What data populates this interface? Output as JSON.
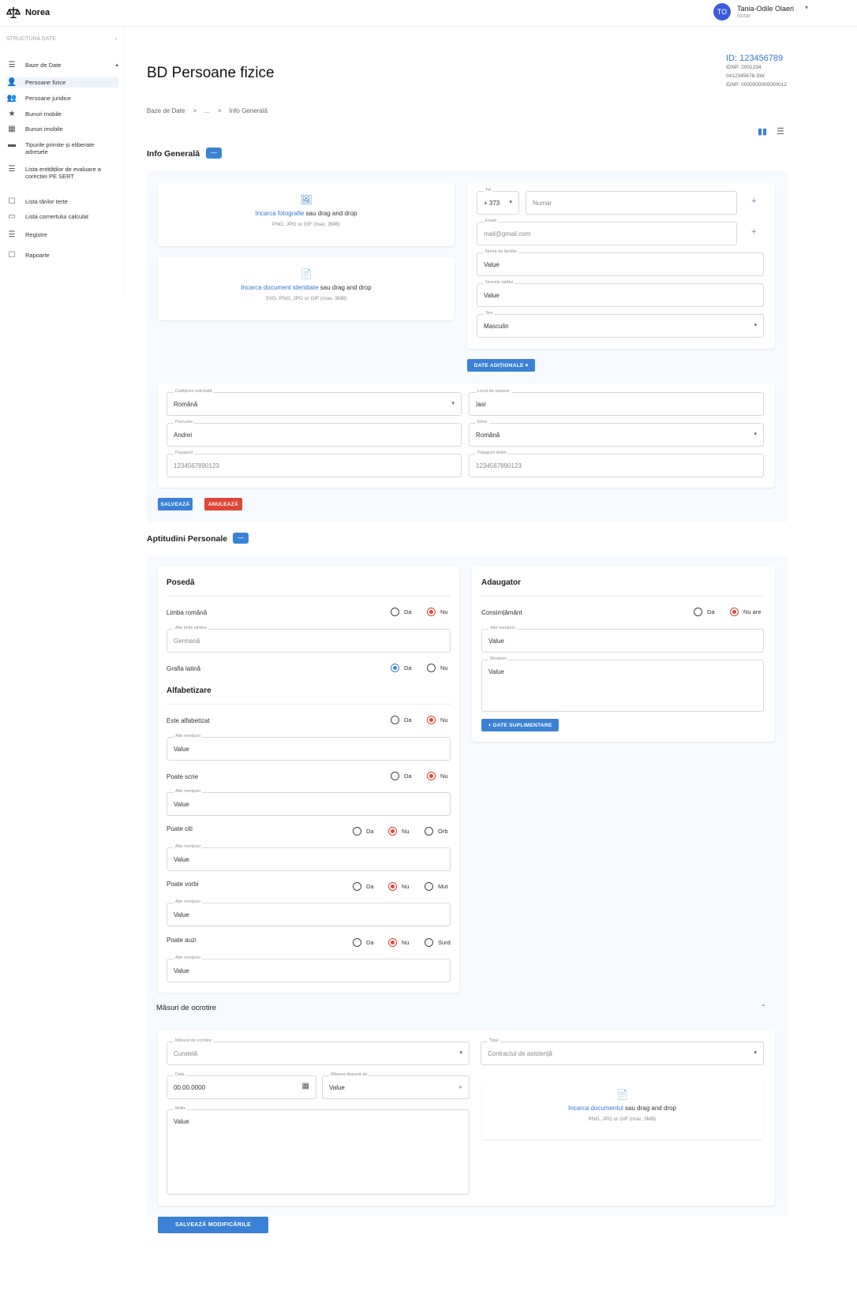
{
  "app": {
    "name": "Norea"
  },
  "user": {
    "initials": "TO",
    "name": "Tania-Odile Olaeri",
    "role": "Notar"
  },
  "sidebar": {
    "heading": "STRUCTURA DATE",
    "items": [
      {
        "label": "Baze de Date",
        "icon": "list-icon"
      },
      {
        "label": "Persoane fizice",
        "icon": "person-icon"
      },
      {
        "label": "Persoane juridice",
        "icon": "group-icon"
      },
      {
        "label": "Bunuri mobile",
        "icon": "star-icon"
      },
      {
        "label": "Bunuri imobile",
        "icon": "building-icon"
      },
      {
        "label": "Tipurile primite și eliberate adresele",
        "icon": "folder-icon"
      },
      {
        "label": "Lista entităților de evaluare a corectiei PE SERT",
        "icon": "list-icon"
      },
      {
        "label": "Lista tărilor terte",
        "icon": "calendar-icon"
      },
      {
        "label": "Lista comertului calculat",
        "icon": "card-icon"
      },
      {
        "label": "Registre",
        "icon": "list-icon"
      },
      {
        "label": "Rapoarte",
        "icon": "calendar-icon"
      }
    ]
  },
  "page": {
    "title": "BD Persoane fizice",
    "id_label": "ID: 123456789",
    "id_lines": [
      "IDNP: 2001234",
      "0412345678-SW",
      "IDNP: 0000000000000012"
    ],
    "breadcrumb": [
      "Baze de Date",
      ">",
      "...",
      ">",
      "Info Generală"
    ]
  },
  "info": {
    "title": "Info Generală",
    "chip": "—",
    "upload_photo": {
      "link": "Incarca fotografie",
      "text": " sau drag and drop",
      "sub": "PNG, JPG or GIF (max. 3MB)"
    },
    "upload_doc": {
      "link": "Incarca document identitate",
      "text": " sau drag and drop",
      "sub": "SVG, PNG, JPG or GIF (max. 3MB)"
    },
    "phone_label": "Tel",
    "phone_code": "+ 373",
    "phone_value": "Numar",
    "email_label": "Email",
    "email_value": "mail@gmail.com",
    "nume_label": "Nume de familie",
    "nume_value": "Value",
    "prenume_label": "Numele tatălui",
    "prenume_value": "Value",
    "sex_label": "Sex",
    "sex_value": "Masculin",
    "more_button": "DATE ADIȚIONALE",
    "cetatenie_label": "Cetățenie solicitată",
    "cetatenie_value": "Română",
    "loc_label": "Locul de naștere",
    "loc_value": "Iasi",
    "prenume2_label": "Prenume",
    "prenume2_value": "Andrei",
    "nationalitate_label": "Etnie",
    "nationalitate_value": "Română",
    "cod1_label": "Pașaport",
    "cod1_value": "1234567890123",
    "cod2_label": "Pașaport străin",
    "cod2_value": "1234567890123",
    "save_button": "SALVEAZĂ",
    "cancel_button": "ANULEAZĂ"
  },
  "aptitudini": {
    "title": "Aptitudini Personale",
    "chip": "—",
    "poseda": {
      "title": "Posedă",
      "limba_label": "Limba română",
      "da": "Da",
      "nu": "Nu",
      "alte_label": "Alte limbi străine",
      "alte_value": "Germană",
      "grafia_label": "Grafia latină"
    },
    "alfabetizare": {
      "title": "Alfabetizare",
      "rows": [
        {
          "label": "Este alfabetizat",
          "field_label": "Alte mențiuni",
          "field_value": "Value"
        },
        {
          "label": "Poate scrie",
          "field_label": "Alte mențiuni",
          "field_value": "Value"
        },
        {
          "label": "Poate citi",
          "field_label": "Alte mențiuni",
          "field_value": "Value",
          "third": "Orb"
        },
        {
          "label": "Poate vorbi",
          "field_label": "Alte mențiuni",
          "field_value": "Value",
          "third": "Mut"
        },
        {
          "label": "Poate auzi",
          "field_label": "Alte mențiuni",
          "field_value": "Value",
          "third": "Surd"
        }
      ]
    },
    "adaugator": {
      "title": "Adaugator",
      "consimtamant_label": "Consimțământ",
      "da": "Da",
      "nu": "Nu are",
      "field1_label": "Alte mențiuni",
      "field1_value": "Value",
      "field2_label": "Mențiuni",
      "field2_value": "Value",
      "button": "+ DATE SUPLIMENTARE"
    }
  },
  "masuri": {
    "title": "Măsuri de ocrotire",
    "tip_label": "Măsura de ocrotire",
    "tip_value": "Curatelă",
    "tip2_label": "Tipul",
    "tip2_value": "Contractul de asistență",
    "data_label": "Data",
    "data_value": "00.00.0000",
    "cauta_label": "Măsura dispusă de",
    "cauta_value": "Value",
    "motiv_label": "Motiv",
    "motiv_value": "Value",
    "upload": {
      "link": "Incarca documentul",
      "text": " sau drag and drop",
      "sub": "PNG, JPG or GIF (max. 3MB)"
    }
  },
  "save_all": "SALVEAZĂ MODIFICĂRILE"
}
